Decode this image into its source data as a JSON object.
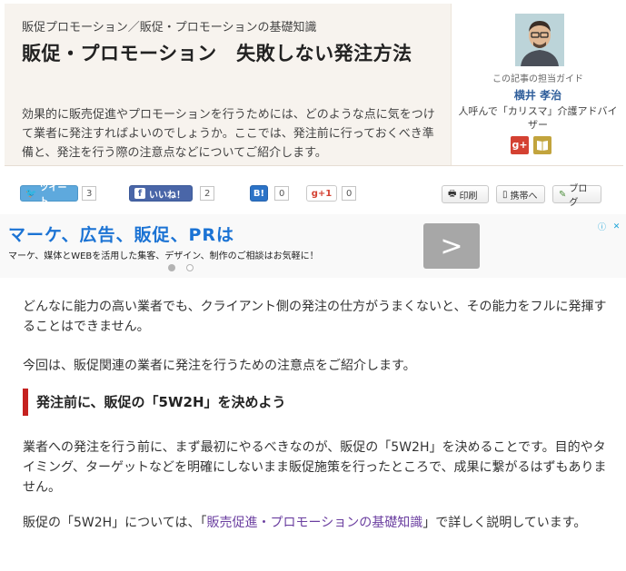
{
  "header": {
    "breadcrumb": "販促プロモーション／販促・プロモーションの基礎知識",
    "title": "販促・プロモーション　失敗しない発注方法",
    "lead": "効果的に販売促進やプロモーションを行うためには、どのような点に気をつけて業者に発注すればよいのでしょうか。ここでは、発注前に行っておくべき準備と、発注を行う際の注意点などについてご紹介します。"
  },
  "guide": {
    "caption": "この記事の担当ガイド",
    "name": "横井 孝治",
    "title": "人呼んで「カリスマ」介護アドバイザー"
  },
  "share": {
    "tweet_label": "ツイート",
    "tweet_count": "3",
    "like_label": "いいね！",
    "like_count": "2",
    "hatena_label": "B!",
    "hatena_count": "0",
    "gplus_label": "g+1",
    "gplus_count": "0",
    "print_label": "印刷",
    "mobile_label": "携帯へ",
    "blog_label": "ブログ"
  },
  "ad": {
    "headline": "マーケ、広告、販促、PRは",
    "subtext": "マーケ、媒体とWEBを活用した集客、デザイン、制作のご相談はお気軽に！",
    "next_symbol": ">"
  },
  "article": {
    "para1": "どんなに能力の高い業者でも、クライアント側の発注の仕方がうまくないと、その能力をフルに発揮することはできません。",
    "para2": "今回は、販促関連の業者に発注を行うための注意点をご紹介します。",
    "heading": "発注前に、販促の「5W2H」を決めよう",
    "para3": "業者への発注を行う前に、まず最初にやるべきなのが、販促の「5W2H」を決めることです。目的やタイミング、ターゲットなどを明確にしないまま販促施策を行ったところで、成果に繋がるはずもありません。",
    "para4_prefix": "販促の「5W2H」については、「",
    "para4_link": "販売促進・プロモーションの基礎知識",
    "para4_suffix": "」で詳しく説明しています。"
  },
  "colors": {
    "heading_bar": "#c5211f",
    "link": "#6b3fa0",
    "ad_headline": "#1b73d4",
    "guide_name": "#2f5e9b"
  }
}
